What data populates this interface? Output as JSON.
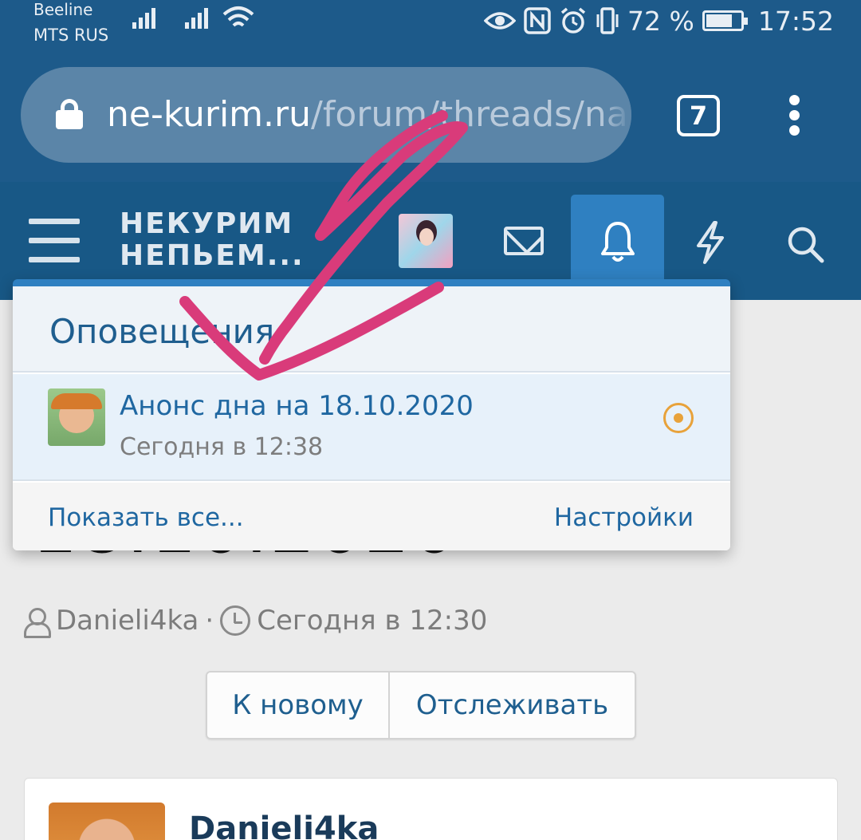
{
  "status_bar": {
    "carrier_1": "Beeline",
    "carrier_2": "MTS RUS",
    "battery_text": "72 %",
    "battery_level_percent": 72,
    "time": "17:52"
  },
  "browser": {
    "url_host": "ne-kurim.ru",
    "url_path": "/forum/threads/na",
    "tab_count": "7"
  },
  "site_header": {
    "logo_line_1": "НЕКУРИМ",
    "logo_line_2": "НЕПЬЕМ..."
  },
  "notifications_popup": {
    "title": "Оповещения",
    "items": [
      {
        "text": "Анонс дна на 18.10.2020",
        "time": "Сегодня в 12:38"
      }
    ],
    "show_all_label": "Показать все...",
    "settings_label": "Настройки"
  },
  "thread": {
    "title_visible": "18.10.2020",
    "author": "Danieli4ka",
    "separator": "·",
    "created": "Сегодня в 12:30",
    "to_new_label": "К новому",
    "watch_label": "Отслеживать"
  },
  "post": {
    "author": "Danieli4ka"
  },
  "colors": {
    "header_blue": "#185886",
    "accent_blue": "#2f80c1",
    "link_blue": "#1f67a1",
    "unread_marker": "#e8a23a",
    "annotation_pink": "#d93b7a"
  }
}
